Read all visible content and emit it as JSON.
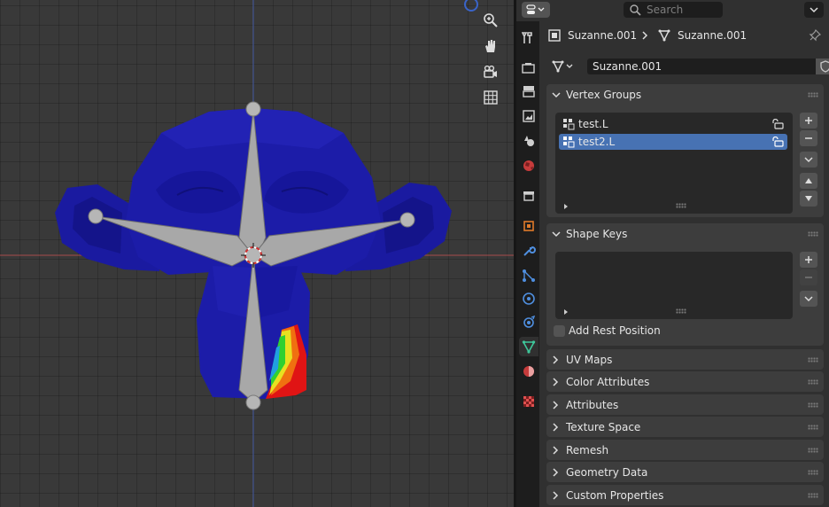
{
  "header": {
    "search_placeholder": "Search"
  },
  "breadcrumb": {
    "object_name": "Suzanne.001",
    "mesh_name": "Suzanne.001"
  },
  "datablock": {
    "mesh_name": "Suzanne.001"
  },
  "vertex_groups": {
    "title": "Vertex Groups",
    "items": [
      {
        "label": "test.L",
        "selected": false
      },
      {
        "label": "test2.L",
        "selected": true
      }
    ]
  },
  "shape_keys": {
    "title": "Shape Keys",
    "add_rest_position": "Add Rest Position"
  },
  "collapsed_panels": [
    "UV Maps",
    "Color Attributes",
    "Attributes",
    "Texture Space",
    "Remesh",
    "Geometry Data",
    "Custom Properties"
  ],
  "tabs": [
    "tool-tab",
    "render-tab",
    "output-tab",
    "view-layer-tab",
    "scene-tab",
    "world-tab",
    "collection-tab",
    "object-tab",
    "modifiers-tab",
    "particles-tab",
    "physics-tab",
    "constraints-tab",
    "data-tab",
    "material-tab",
    "texture-tab"
  ],
  "colors": {
    "selected_row": "#4772b3",
    "panel_bg": "#3d3d3d",
    "editor_bg": "#303030",
    "mesh_blue": "#1c1ca8",
    "bone_gray": "#a8a8a8",
    "x_axis": "#a84a4a",
    "y_axis": "#4a5fa8"
  }
}
